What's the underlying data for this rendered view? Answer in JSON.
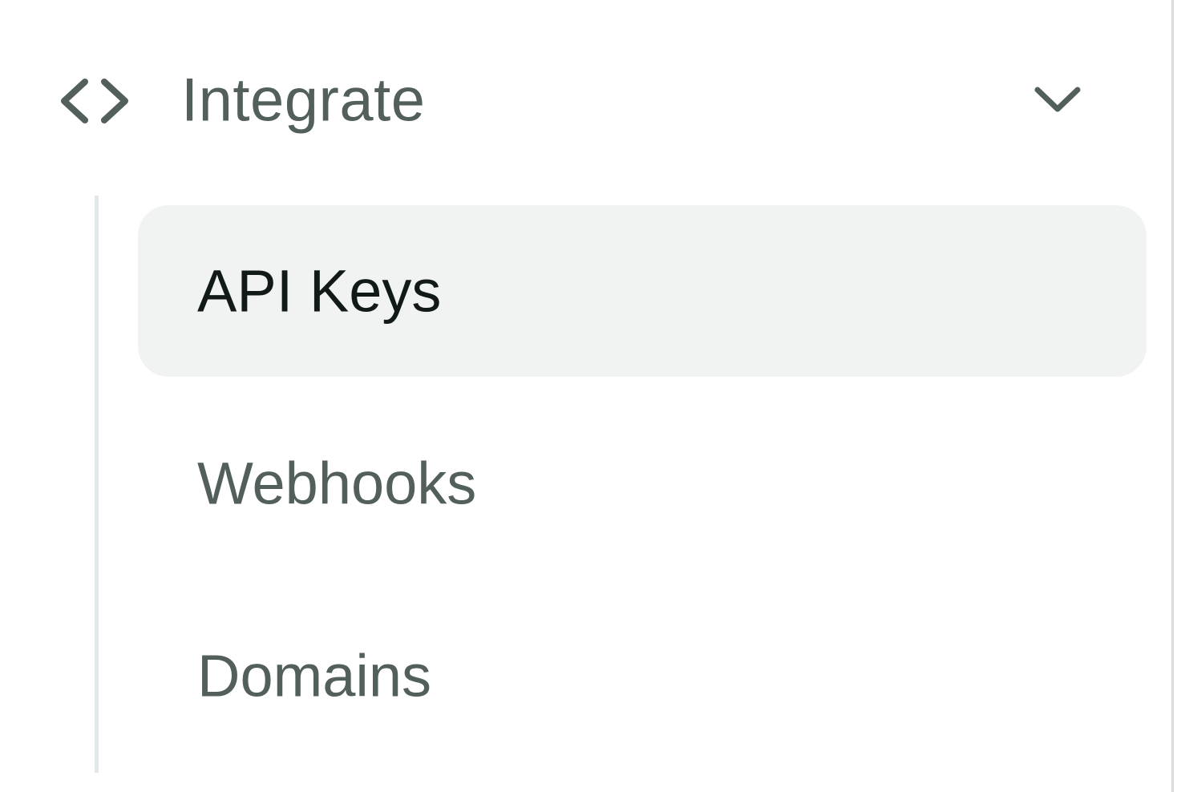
{
  "section": {
    "label": "Integrate",
    "icon": "code-icon",
    "expanded": true,
    "toggle_icon": "chevron-down-icon"
  },
  "items": [
    {
      "label": "API Keys",
      "active": true
    },
    {
      "label": "Webhooks",
      "active": false
    },
    {
      "label": "Domains",
      "active": false
    }
  ],
  "colors": {
    "text_muted": "#535f5b",
    "text_active": "#121a17",
    "active_bg": "#f1f3f2",
    "tree_line": "#e2e7ea"
  }
}
